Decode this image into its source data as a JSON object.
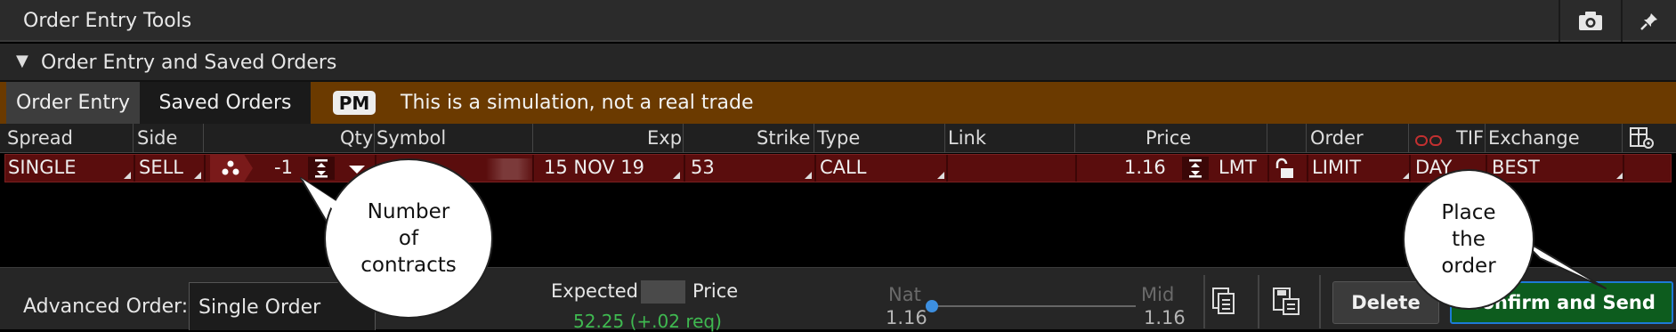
{
  "title_bar": {
    "title": "Order Entry Tools",
    "icons": [
      "camera-icon",
      "pin-icon"
    ]
  },
  "section": {
    "label": "Order Entry and Saved Orders"
  },
  "tabs": {
    "order_entry": "Order Entry",
    "saved_orders": "Saved Orders"
  },
  "banner": {
    "badge": "PM",
    "message": "This is a simulation, not a real trade",
    "color": "#6b3a00"
  },
  "columns": {
    "spread": "Spread",
    "side": "Side",
    "qty": "Qty",
    "symbol": "Symbol",
    "exp": "Exp",
    "strike": "Strike",
    "type": "Type",
    "link": "Link",
    "price": "Price",
    "order": "Order",
    "tif": "TIF",
    "exchange": "Exchange"
  },
  "order": {
    "spread": "SINGLE",
    "side": "SELL",
    "qty": "-1",
    "exp": "15 NOV 19",
    "strike": "53",
    "type": "CALL",
    "price": "1.16",
    "price_type": "LMT",
    "order_type": "LIMIT",
    "tif": "DAY",
    "exchange": "BEST",
    "row_color": "#5a0d0d"
  },
  "callouts": {
    "qty_note": "Number of contracts",
    "send_note": "Place the order"
  },
  "bottom": {
    "advanced_label": "Advanced Order:",
    "advanced_value": "Single Order",
    "expected_label": "Expected",
    "price_label": "Price",
    "expected_value": "52.25 (+.02 req)",
    "nat_label": "Nat",
    "nat_value": "1.16",
    "mid_label": "Mid",
    "mid_value": "1.16",
    "delete_label": "Delete",
    "confirm_label": "Confirm and Send",
    "confirm_color": "#0d5c1e",
    "expected_color": "#3fb950"
  }
}
